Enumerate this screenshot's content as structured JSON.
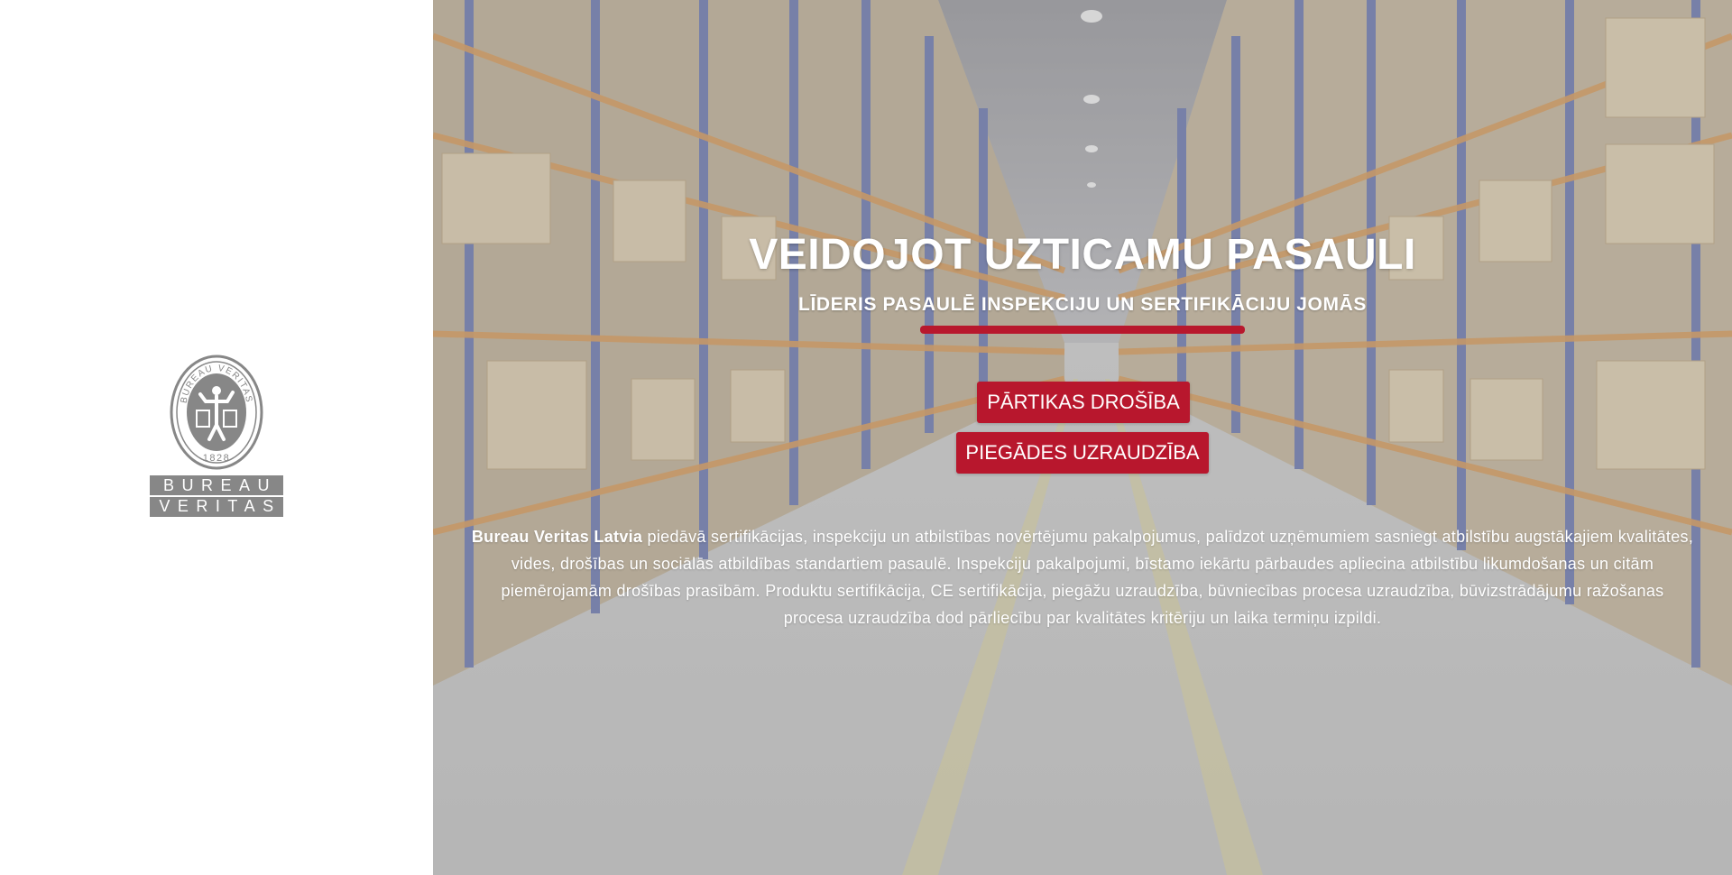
{
  "brand": {
    "seal_text": "BUREAU VERITAS",
    "seal_year": "1828",
    "wordmark_line1": "BUREAU",
    "wordmark_line2": "VERITAS",
    "color_gray": "#878787"
  },
  "hero": {
    "title": "VEIDOJOT UZTICAMU PASAULI",
    "subtitle": "LĪDERIS PASAULĒ INSPEKCIJU UN SERTIFIKĀCIJU JOMĀS",
    "accent_color": "#b8182d",
    "background": "warehouse-photo"
  },
  "buttons": {
    "food_safety": "PĀRTIKAS DROŠĪBA",
    "supply_supervision": "PIEGĀDES UZRAUDZĪBA"
  },
  "description": {
    "company": "Bureau Veritas Latvia",
    "text": " piedāvā sertifikācijas, inspekciju un atbilstības novērtējumu pakalpojumus, palīdzot uzņēmumiem sasniegt atbilstību augstākajiem kvalitātes, vides, drošības un sociālās atbildības standartiem pasaulē. Inspekciju pakalpojumi, bīstamo iekārtu pārbaudes apliecina atbilstību likumdošanas un citām piemērojamām drošības prasībām. Produktu sertifikācija, CE sertifikācija, piegāžu uzraudzība, būvniecības  procesa  uzraudzība, būvizstrādājumu ražošanas procesa uzraudzība dod pārliecību par kvalitātes kritēriju un laika termiņu izpildi."
  }
}
